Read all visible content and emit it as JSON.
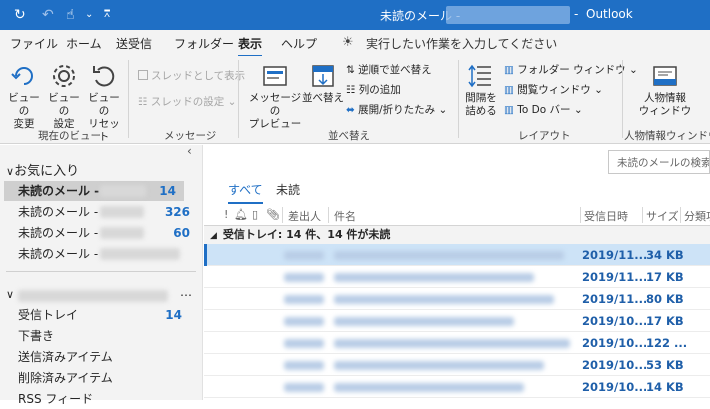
{
  "titlebar": {
    "title": "未読のメール -",
    "separator": "-",
    "app": "Outlook"
  },
  "menu": {
    "tabs": [
      "ファイル",
      "ホーム",
      "送受信",
      "フォルダー",
      "表示",
      "ヘルプ"
    ],
    "active_tab": "表示",
    "tell_me": "実行したい作業を入力してください"
  },
  "ribbon": {
    "current_view": {
      "label": "現在のビュー",
      "change_view": "ビューの\n変更",
      "view_settings": "ビューの\n設定",
      "reset_view": "ビューの\nリセット"
    },
    "messages": {
      "label": "メッセージ",
      "show_as_conversations": "スレッドとして表示",
      "conversation_settings": "スレッドの設定"
    },
    "arrangement": {
      "label": "並べ替え",
      "message_preview": "メッセージの\nプレビュー",
      "arrange_by": "並べ替え",
      "reverse_sort": "逆順で並べ替え",
      "add_columns": "列の追加",
      "expand_collapse": "展開/折りたたみ"
    },
    "layout": {
      "label": "レイアウト",
      "spacing": "間隔を\n詰める",
      "folder_pane": "フォルダー ウィンドウ",
      "reading_pane": "閲覧ウィンドウ",
      "todo_bar": "To Do バー"
    },
    "people_pane": {
      "label": "人物情報ウィンドウ",
      "button": "人物情報\nウィンドウ"
    }
  },
  "folder_pane": {
    "favorites_header": "お気に入り",
    "favorites": [
      {
        "name": "未読のメール -",
        "count": "14"
      },
      {
        "name": "未読のメール -",
        "count": "326"
      },
      {
        "name": "未読のメール -",
        "count": "60"
      },
      {
        "name": "未読のメール -",
        "count": ""
      }
    ],
    "account_more": "…",
    "folders": [
      {
        "name": "受信トレイ",
        "count": "14"
      },
      {
        "name": "下書き",
        "count": ""
      },
      {
        "name": "送信済みアイテム",
        "count": ""
      },
      {
        "name": "削除済みアイテム",
        "count": ""
      },
      {
        "name": "RSS フィード",
        "count": ""
      }
    ]
  },
  "message_list": {
    "search_placeholder": "未読のメールの検索",
    "filter_tabs": [
      "すべて",
      "未読"
    ],
    "columns": {
      "from": "差出人",
      "subject": "件名",
      "received": "受信日時",
      "size": "サイズ",
      "category": "分類項"
    },
    "group_header": "受信トレイ: 14 件、14 件が未読",
    "rows": [
      {
        "date": "2019/11...",
        "size": "34 KB"
      },
      {
        "date": "2019/11...",
        "size": "17 KB"
      },
      {
        "date": "2019/11...",
        "size": "80 KB"
      },
      {
        "date": "2019/10...",
        "size": "17 KB"
      },
      {
        "date": "2019/10...",
        "size": "122 ..."
      },
      {
        "date": "2019/10...",
        "size": "53 KB"
      },
      {
        "date": "2019/10...",
        "size": "14 KB"
      }
    ]
  },
  "colors": {
    "accent": "#1f6fc5",
    "titlebar": "#1f6fc5",
    "selected_row": "#cde3f7",
    "count": "#1f6fc5"
  }
}
